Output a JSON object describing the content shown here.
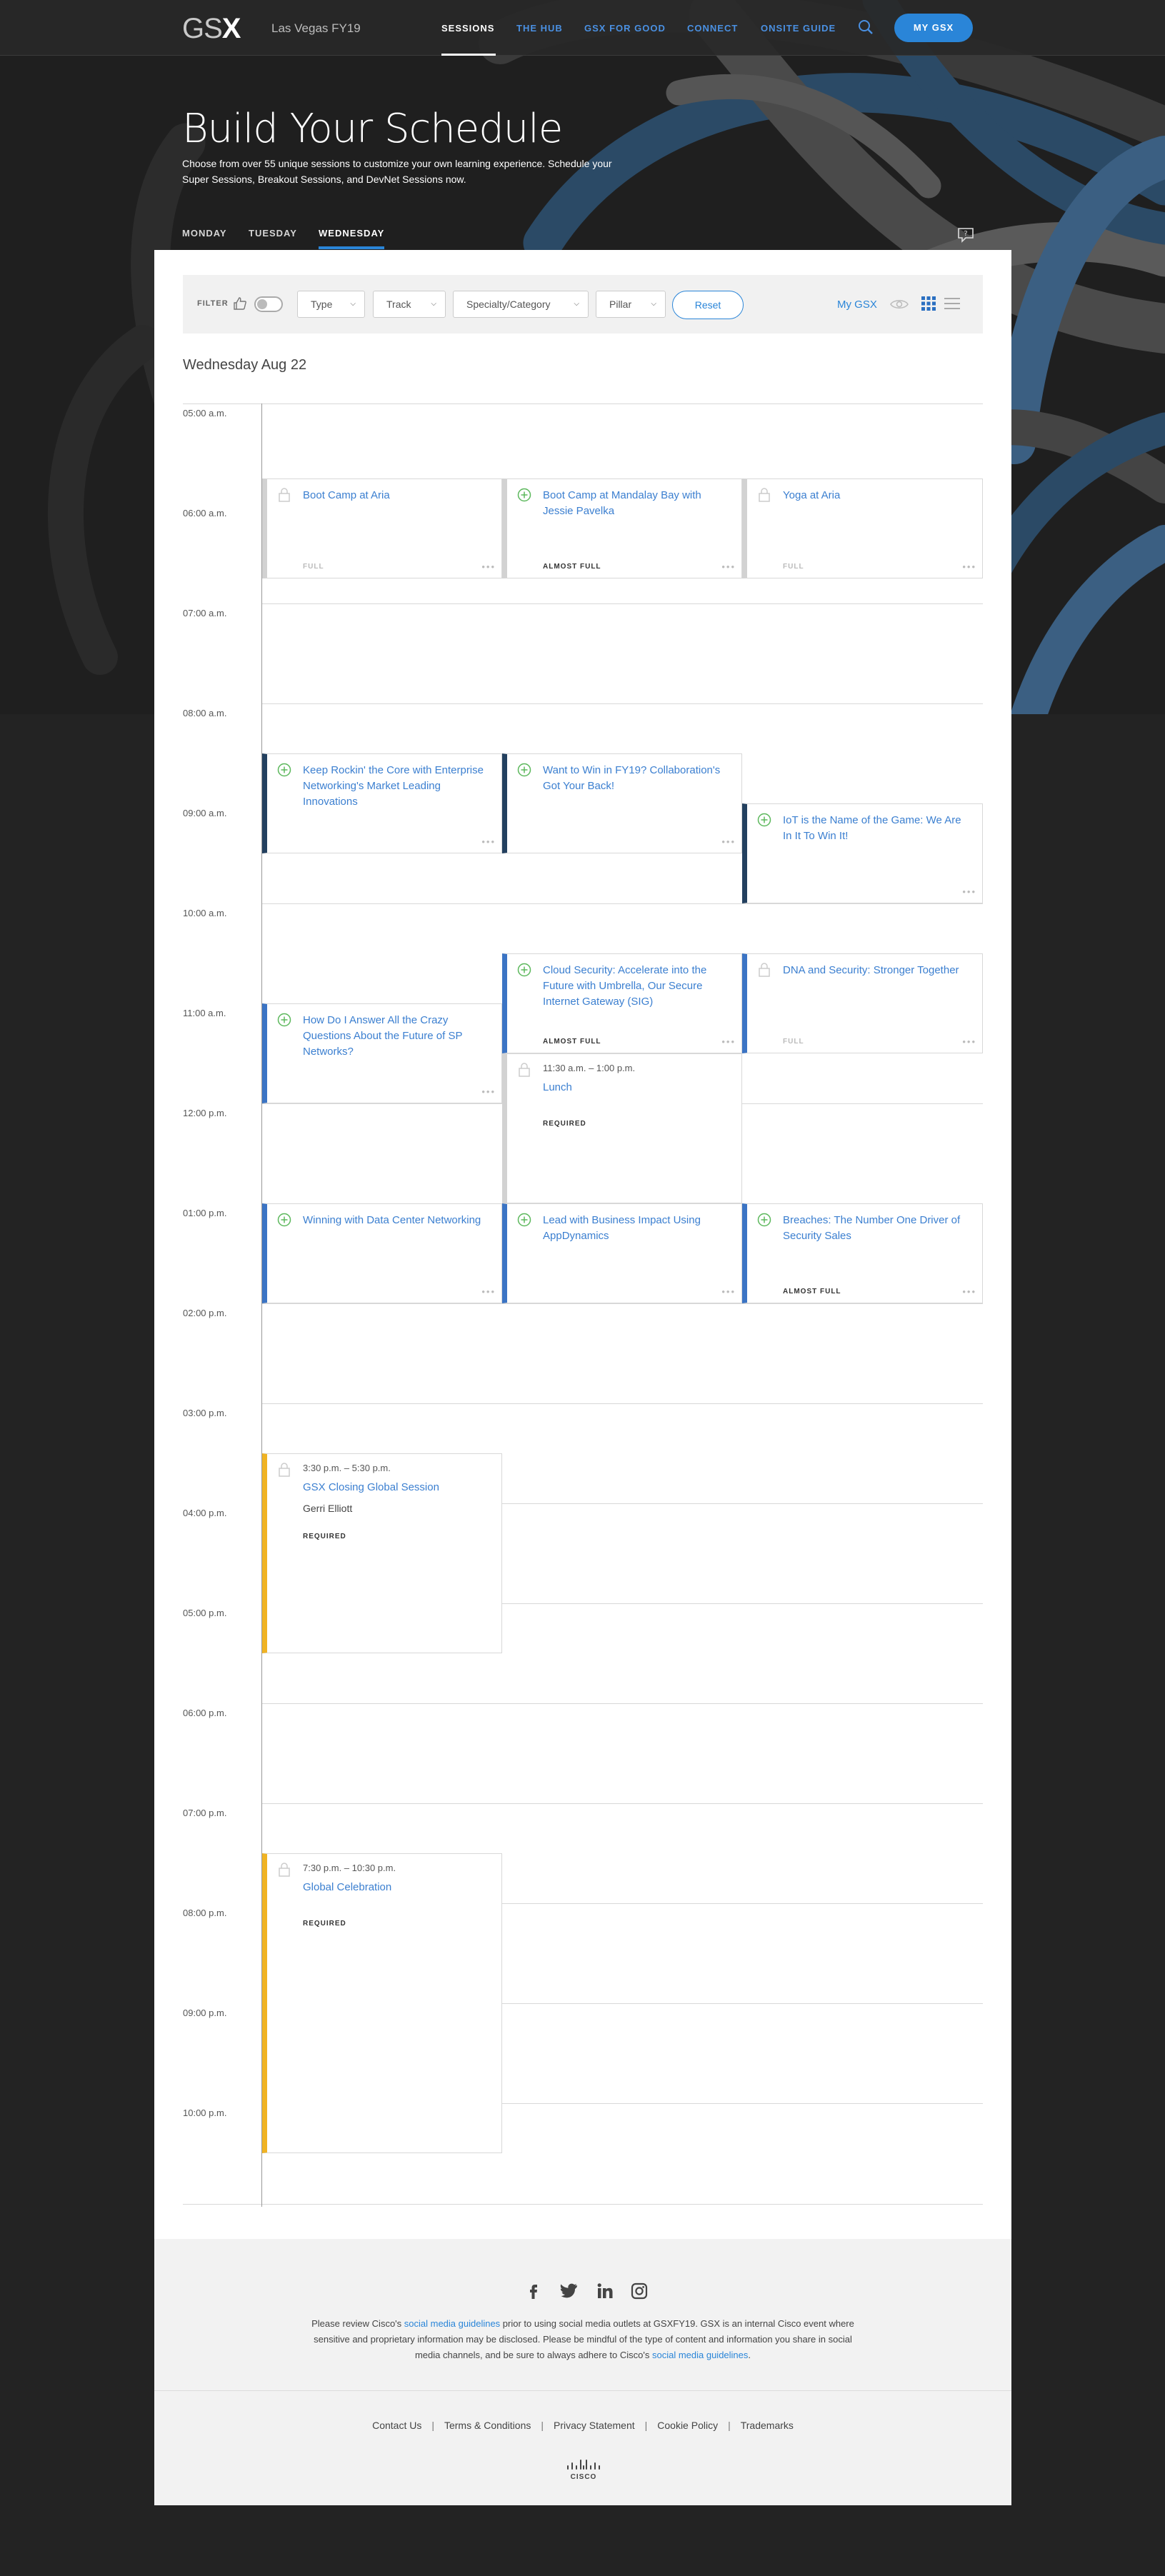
{
  "nav": {
    "logo_prefix": "GS",
    "logo_x": "X",
    "event_name": "Las Vegas FY19",
    "links": [
      "SESSIONS",
      "THE HUB",
      "GSX FOR GOOD",
      "CONNECT",
      "ONSITE GUIDE"
    ],
    "active_link": "SESSIONS",
    "button_label": "MY GSX"
  },
  "hero": {
    "title": "Build Your Schedule",
    "subtitle": "Choose from over 55 unique sessions to customize your own learning experience. Schedule your Super Sessions, Breakout Sessions, and DevNet Sessions now.",
    "days": [
      "MONDAY",
      "TUESDAY",
      "WEDNESDAY"
    ],
    "active_day": "WEDNESDAY"
  },
  "filters": {
    "label": "FILTER",
    "dropdowns": [
      "Type",
      "Track",
      "Specialty/Category",
      "Pillar"
    ],
    "reset_label": "Reset",
    "my_gsx_label": "My GSX"
  },
  "date_heading": "Wednesday Aug 22",
  "time_labels": [
    "05:00 a.m.",
    "06:00 a.m.",
    "07:00 a.m.",
    "08:00 a.m.",
    "09:00 a.m.",
    "10:00 a.m.",
    "11:00 a.m.",
    "12:00 p.m.",
    "01:00 p.m.",
    "02:00 p.m.",
    "03:00 p.m.",
    "04:00 p.m.",
    "05:00 p.m.",
    "06:00 p.m.",
    "07:00 p.m.",
    "08:00 p.m.",
    "09:00 p.m.",
    "10:00 p.m."
  ],
  "sessions": [
    {
      "title": "Boot Camp at Aria",
      "status": "FULL",
      "icon": "lock-icon",
      "color": "#d2d2d2"
    },
    {
      "title": "Boot Camp at Mandalay Bay with Jessie Pavelka",
      "status": "ALMOST FULL",
      "icon": "add-circle-icon",
      "color": "#d2d2d2"
    },
    {
      "title": "Yoga at Aria",
      "status": "FULL",
      "icon": "lock-icon",
      "color": "#d2d2d2"
    },
    {
      "title": "Keep Rockin' the Core with Enterprise Networking's Market Leading Innovations",
      "status": "",
      "icon": "add-circle-icon",
      "color": "#23405f"
    },
    {
      "title": "Want to Win in FY19? Collaboration's Got Your Back!",
      "status": "",
      "icon": "add-circle-icon",
      "color": "#23405f"
    },
    {
      "title": "IoT is the Name of the Game: We Are In It To Win It!",
      "status": "",
      "icon": "add-circle-icon",
      "color": "#23405f"
    },
    {
      "title": "Cloud Security: Accelerate into the Future with Umbrella, Our Secure Internet Gateway (SIG)",
      "status": "ALMOST FULL",
      "icon": "add-circle-icon",
      "color": "#3b74c4"
    },
    {
      "title": "DNA and Security: Stronger Together",
      "status": "FULL",
      "icon": "lock-icon",
      "color": "#3b74c4"
    },
    {
      "title": "How Do I Answer All the Crazy Questions About the Future of SP Networks?",
      "status": "",
      "icon": "add-circle-icon",
      "color": "#3b74c4"
    },
    {
      "title": "Winning with Data Center Networking",
      "status": "",
      "icon": "add-circle-icon",
      "color": "#3b74c4"
    },
    {
      "title": "Lead with Business Impact Using AppDynamics",
      "status": "",
      "icon": "add-circle-icon",
      "color": "#3b74c4"
    },
    {
      "title": "Breaches: The Number One Driver of Security Sales",
      "status": "ALMOST FULL",
      "icon": "add-circle-icon",
      "color": "#3b74c4"
    }
  ],
  "required_sessions": [
    {
      "time": "11:30 a.m. – 1:00 p.m.",
      "title": "Lunch",
      "speaker": "",
      "status": "REQUIRED",
      "color": "#d2d2d2"
    },
    {
      "time": "3:30 p.m. – 5:30 p.m.",
      "title": "GSX Closing Global Session",
      "speaker": "Gerri Elliott",
      "status": "REQUIRED",
      "color": "#f0b323"
    },
    {
      "time": "7:30 p.m. – 10:30 p.m.",
      "title": "Global Celebration",
      "speaker": "",
      "status": "REQUIRED",
      "color": "#f0b323"
    }
  ],
  "footer": {
    "social_icons": [
      "facebook-icon",
      "twitter-icon",
      "linkedin-icon",
      "instagram-icon"
    ],
    "text_1": "Please review Cisco's ",
    "link_1": "social media guidelines",
    "text_2": " prior to using social media outlets at GSXFY19. GSX is an internal Cisco event where sensitive and proprietary information may be disclosed. Please be mindful of the type of content and information you share in social media channels, and be sure to always adhere to Cisco's ",
    "link_2": "social media guidelines",
    "text_3": ".",
    "links": [
      "Contact Us",
      "Terms & Conditions",
      "Privacy Statement",
      "Cookie Policy",
      "Trademarks"
    ],
    "logo_text": "CISCO"
  }
}
